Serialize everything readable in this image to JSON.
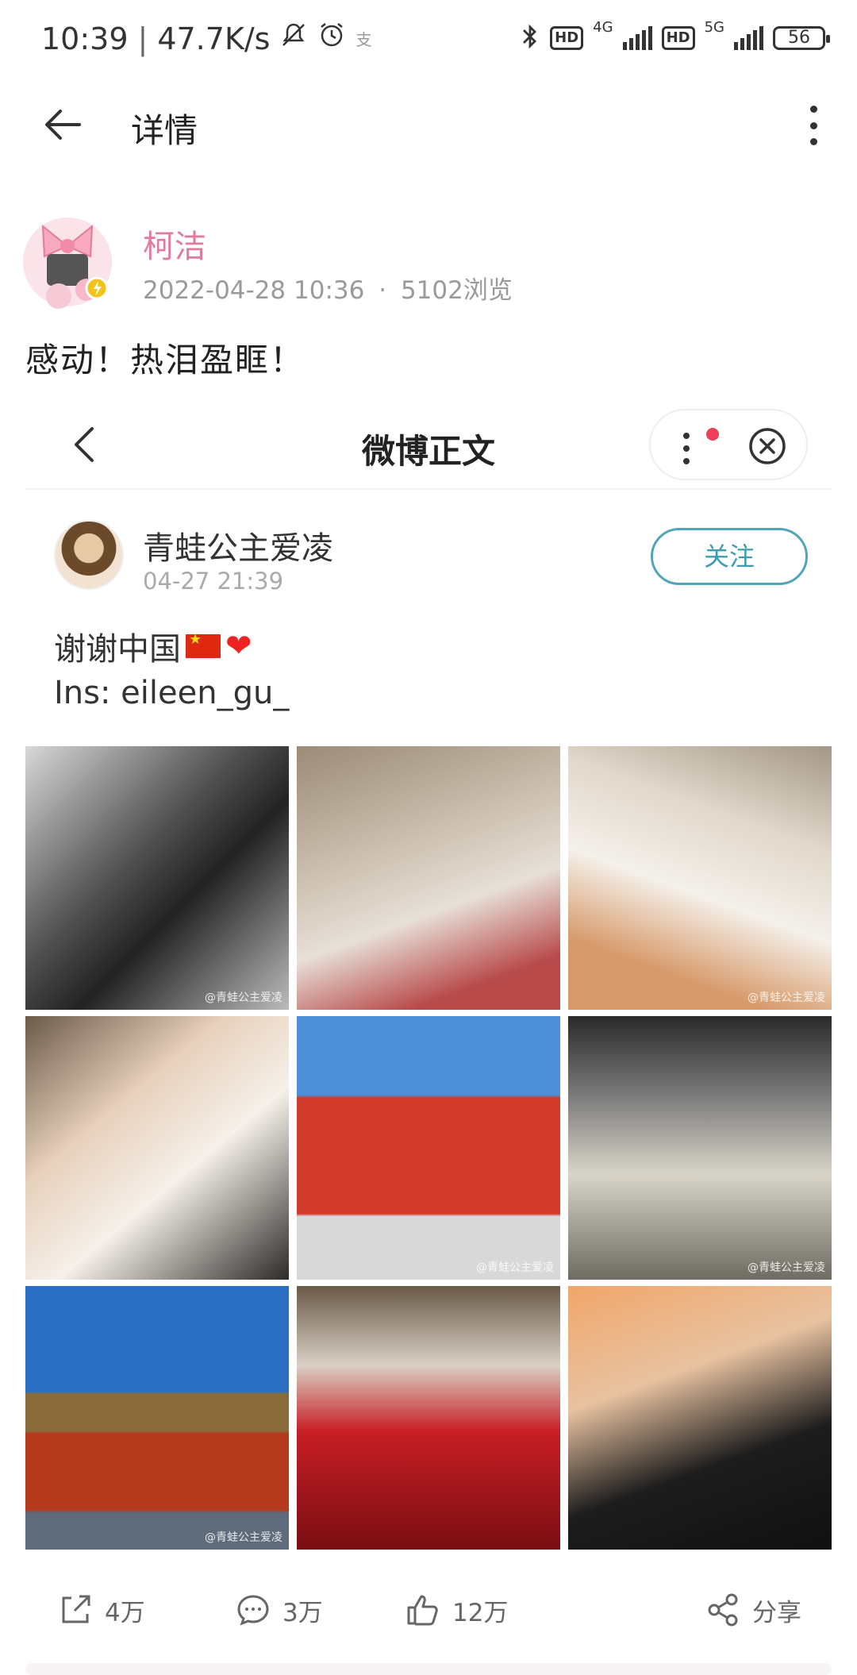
{
  "status_bar": {
    "time": "10:39",
    "speed": "47.7K/s",
    "alipay_icon": "支",
    "network_4g": "4G",
    "network_5g": "5G",
    "hd": "HD",
    "battery": "56",
    "icons": [
      "mute-icon",
      "alarm-icon",
      "alipay-icon",
      "bluetooth-icon",
      "signal-icon",
      "battery-icon"
    ]
  },
  "header": {
    "title": "详情"
  },
  "post": {
    "author": "柯洁",
    "date": "2022-04-28 10:36",
    "separator": "·",
    "views": "5102浏览",
    "text": "感动！热泪盈眶！"
  },
  "embed": {
    "title": "微博正文",
    "user_name": "青蛙公主爱凌",
    "user_time": "04-27 21:39",
    "follow_label": "关注",
    "text_line1": "谢谢中国",
    "text_line2": "Ins: eileen_gu_",
    "watermark": "@青蛙公主爱凌",
    "images": [
      "backstage makeup scene",
      "framed portrait paintings",
      "polaroid photos",
      "portrait makeup",
      "red circular screen building",
      "long dinner table",
      "palace at dusk",
      "red roses under lamps",
      "smiling woman with name card"
    ]
  },
  "toolbar": {
    "repost_count": "4万",
    "comment_count": "3万",
    "like_count": "12万",
    "share_label": "分享"
  },
  "colors": {
    "author_pink": "#e27b9b",
    "follow_teal": "#3f9bb0",
    "notification_red": "#ef3e57"
  }
}
